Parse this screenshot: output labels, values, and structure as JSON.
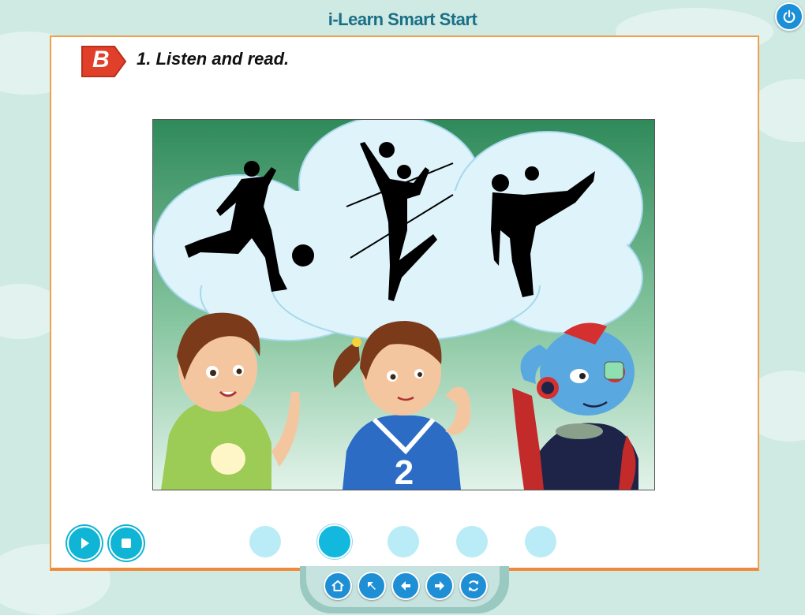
{
  "app": {
    "title": "i-Learn Smart Start"
  },
  "lesson": {
    "section_letter": "B",
    "instruction": "1. Listen and read."
  },
  "scene": {
    "shirt_number": "2"
  },
  "audio_controls": [
    {
      "name": "play-button",
      "icon": "play-icon"
    },
    {
      "name": "stop-button",
      "icon": "stop-icon"
    }
  ],
  "pages": {
    "count": 5,
    "active_index": 1
  },
  "nav_buttons": [
    {
      "name": "home-button",
      "icon": "home-icon"
    },
    {
      "name": "menu-back-button",
      "icon": "arrow-up-left-icon"
    },
    {
      "name": "previous-button",
      "icon": "arrow-left-icon"
    },
    {
      "name": "next-button",
      "icon": "arrow-right-icon"
    },
    {
      "name": "refresh-button",
      "icon": "refresh-icon"
    }
  ],
  "colors": {
    "accent": "#10b5d6",
    "panel_border": "#f0a04b",
    "badge": "#e0402a"
  }
}
